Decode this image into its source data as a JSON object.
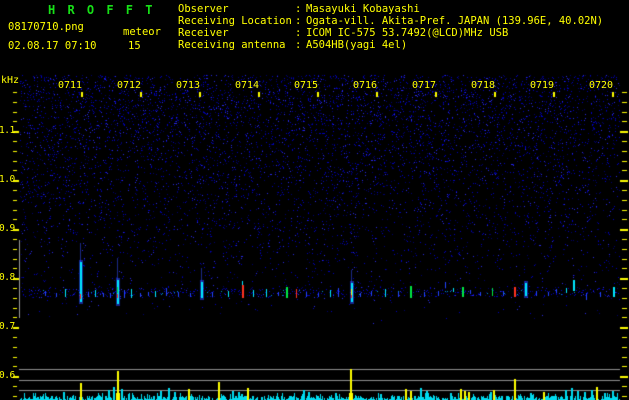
{
  "header": {
    "app_title": "H R O F F T",
    "filename": "08170710.png",
    "mode": "meteor",
    "datetime": "02.08.17 07:10",
    "meteor_count": "15",
    "colon": ":",
    "info": [
      {
        "label": "Observer",
        "value": "Masayuki Kobayashi"
      },
      {
        "label": "Receiving Location",
        "value": "Ogata-vill. Akita-Pref. JAPAN (139.96E, 40.02N)"
      },
      {
        "label": "Receiver",
        "value": "ICOM IC-575 53.7492(@LCD)MHz USB"
      },
      {
        "label": "Receiving antenna",
        "value": "A504HB(yagi 4el)"
      }
    ]
  },
  "colors": {
    "accent_yellow": "#ffff00",
    "title_green": "#17e017",
    "noise_blue_dark": "#000070",
    "noise_blue": "#0000c0",
    "noise_blue_bright": "#2a2ae8",
    "echo_cyan": "#00e8ff",
    "echo_blue": "#2244ff",
    "echo_green": "#00e844",
    "echo_red": "#ff3220",
    "echo_yellow": "#ffee00",
    "grid_gray": "#8f8f8f",
    "marker_gray": "#9a9a9a",
    "strength_cyan": "#00dcf0"
  },
  "chart_data": {
    "type": "heatmap",
    "subtype": "radio-meteor-spectrogram-with-strength-strip",
    "x_axis": {
      "tick_labels": [
        "0711",
        "0712",
        "0713",
        "0714",
        "0715",
        "0716",
        "0717",
        "0718",
        "0719",
        "0720"
      ]
    },
    "y_axis": {
      "label": "kHz",
      "tick_labels": [
        "1.1",
        "1.0",
        "0.9",
        "0.8",
        "0.7",
        "0.6"
      ]
    },
    "echo_band_khz": 0.8,
    "meteor_echo_count_shown": 15,
    "echo_events": [
      [
        45,
        291,
        5,
        "b"
      ],
      [
        56,
        293,
        4,
        "b"
      ],
      [
        65,
        289,
        8,
        "c"
      ],
      [
        80,
        262,
        40,
        "c"
      ],
      [
        80,
        294,
        5,
        "r"
      ],
      [
        88,
        292,
        5,
        "b"
      ],
      [
        95,
        290,
        7,
        "c"
      ],
      [
        103,
        293,
        4,
        "b"
      ],
      [
        110,
        293,
        5,
        "b"
      ],
      [
        117,
        280,
        24,
        "c"
      ],
      [
        117,
        287,
        6,
        "g"
      ],
      [
        117,
        294,
        4,
        "r"
      ],
      [
        124,
        290,
        8,
        "b"
      ],
      [
        131,
        289,
        9,
        "c"
      ],
      [
        140,
        293,
        4,
        "b"
      ],
      [
        148,
        292,
        4,
        "b"
      ],
      [
        155,
        291,
        6,
        "c"
      ],
      [
        166,
        288,
        8,
        "b"
      ],
      [
        178,
        292,
        5,
        "b"
      ],
      [
        190,
        293,
        4,
        "b"
      ],
      [
        201,
        282,
        16,
        "c"
      ],
      [
        212,
        292,
        5,
        "b"
      ],
      [
        228,
        291,
        6,
        "c"
      ],
      [
        242,
        281,
        5,
        "c"
      ],
      [
        242,
        285,
        13,
        "r"
      ],
      [
        253,
        290,
        7,
        "c"
      ],
      [
        266,
        289,
        8,
        "c"
      ],
      [
        278,
        292,
        4,
        "b"
      ],
      [
        286,
        287,
        11,
        "g"
      ],
      [
        296,
        289,
        9,
        "r"
      ],
      [
        306,
        292,
        5,
        "b"
      ],
      [
        318,
        293,
        4,
        "b"
      ],
      [
        330,
        290,
        7,
        "c"
      ],
      [
        338,
        288,
        9,
        "b"
      ],
      [
        351,
        283,
        19,
        "c"
      ],
      [
        351,
        289,
        6,
        "y"
      ],
      [
        351,
        295,
        3,
        "r"
      ],
      [
        360,
        293,
        4,
        "b"
      ],
      [
        371,
        291,
        5,
        "b"
      ],
      [
        385,
        289,
        8,
        "c"
      ],
      [
        398,
        292,
        5,
        "b"
      ],
      [
        410,
        286,
        12,
        "g"
      ],
      [
        424,
        292,
        5,
        "b"
      ],
      [
        438,
        291,
        5,
        "b"
      ],
      [
        445,
        282,
        6,
        "b"
      ],
      [
        453,
        288,
        4,
        "c"
      ],
      [
        462,
        287,
        10,
        "g"
      ],
      [
        470,
        290,
        4,
        "b"
      ],
      [
        480,
        292,
        4,
        "b"
      ],
      [
        492,
        288,
        8,
        "g"
      ],
      [
        503,
        291,
        5,
        "b"
      ],
      [
        514,
        287,
        10,
        "r"
      ],
      [
        525,
        283,
        13,
        "c"
      ],
      [
        536,
        291,
        5,
        "b"
      ],
      [
        548,
        292,
        4,
        "b"
      ],
      [
        556,
        289,
        4,
        "b"
      ],
      [
        566,
        288,
        5,
        "c"
      ],
      [
        573,
        280,
        11,
        "c"
      ],
      [
        586,
        293,
        7,
        "b"
      ],
      [
        600,
        292,
        5,
        "b"
      ],
      [
        613,
        287,
        10,
        "c"
      ]
    ],
    "faint_trails": [
      [
        80,
        243,
        20
      ],
      [
        117,
        258,
        22
      ],
      [
        201,
        268,
        14
      ],
      [
        351,
        270,
        13
      ]
    ],
    "strength_spikes_yellow": [
      [
        80,
        17
      ],
      [
        117,
        29
      ],
      [
        188,
        11
      ],
      [
        218,
        18
      ],
      [
        247,
        12
      ],
      [
        350,
        31
      ],
      [
        405,
        11
      ],
      [
        410,
        9
      ],
      [
        460,
        11
      ],
      [
        464,
        9
      ],
      [
        468,
        8
      ],
      [
        493,
        10
      ],
      [
        514,
        21
      ],
      [
        543,
        8
      ],
      [
        596,
        13
      ]
    ],
    "strength_spikes_cyan": [
      [
        63,
        8
      ],
      [
        108,
        10
      ],
      [
        113,
        13
      ],
      [
        121,
        11
      ],
      [
        160,
        9
      ],
      [
        168,
        12
      ],
      [
        174,
        8
      ],
      [
        232,
        9
      ],
      [
        238,
        8
      ],
      [
        303,
        10
      ],
      [
        308,
        8
      ],
      [
        335,
        7
      ],
      [
        420,
        12
      ],
      [
        426,
        9
      ],
      [
        450,
        7
      ],
      [
        490,
        8
      ],
      [
        530,
        7
      ],
      [
        565,
        10
      ],
      [
        571,
        12
      ],
      [
        577,
        9
      ],
      [
        584,
        8
      ],
      [
        591,
        10
      ],
      [
        604,
        7
      ],
      [
        612,
        9
      ]
    ]
  }
}
